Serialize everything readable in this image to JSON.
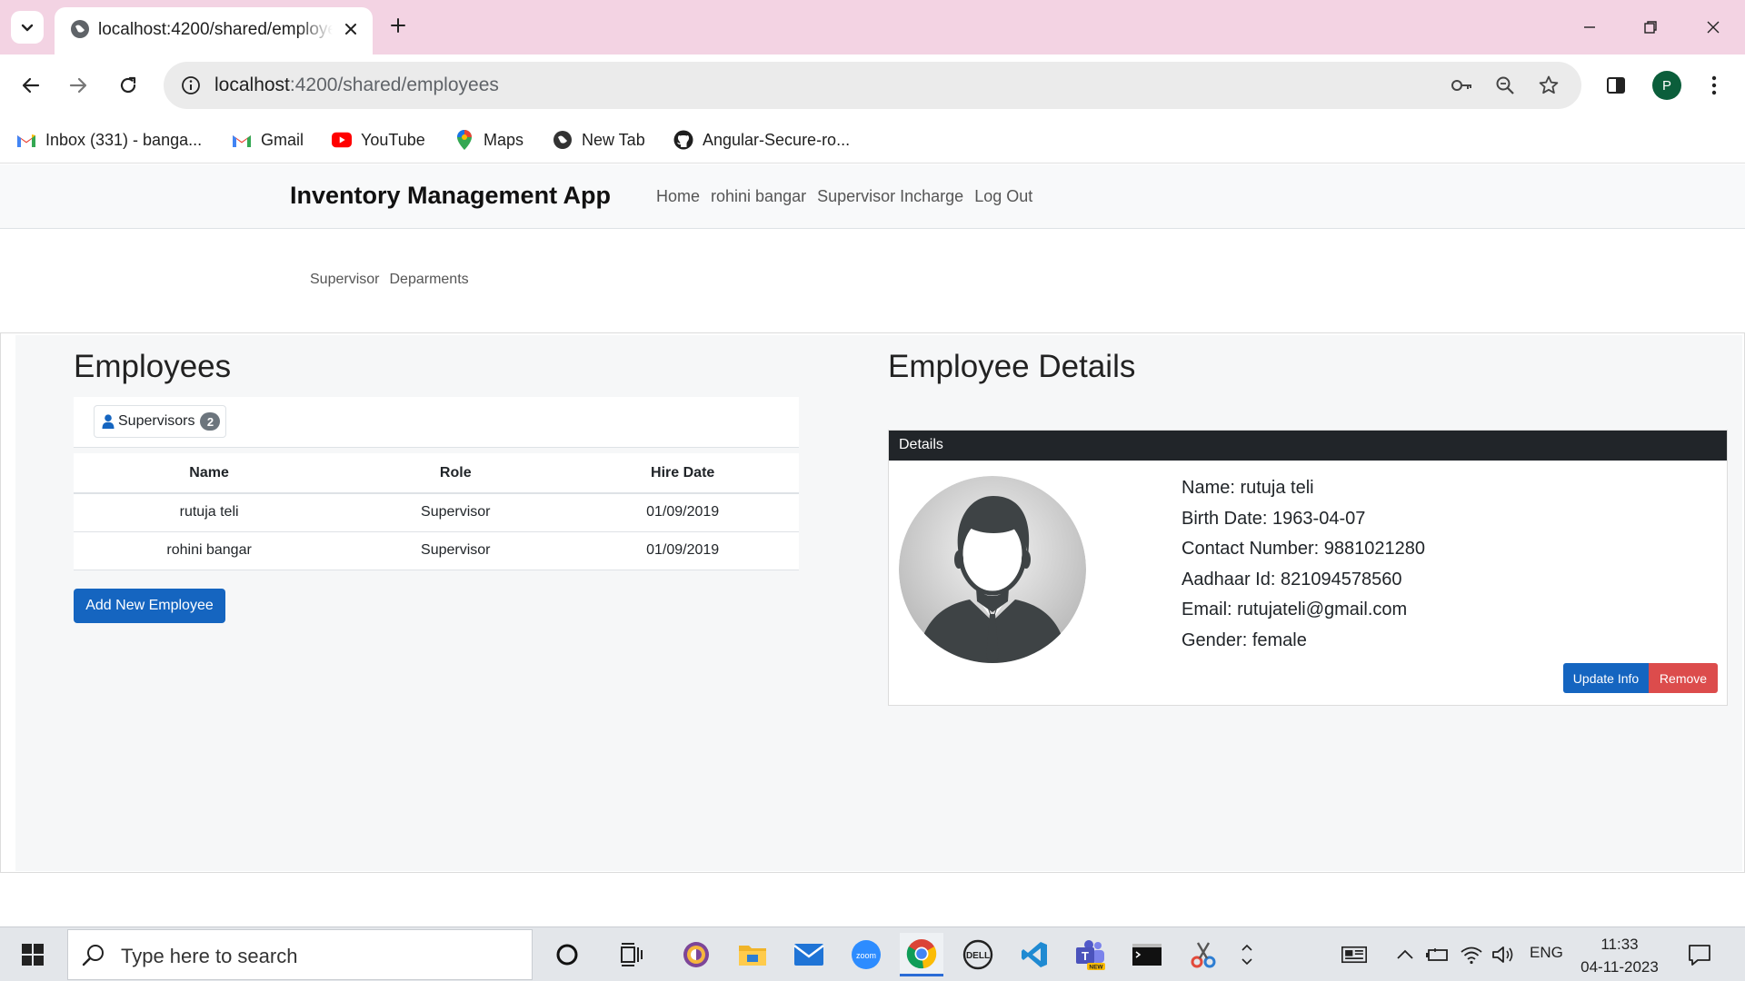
{
  "browser": {
    "tab_title": "localhost:4200/shared/employees",
    "url_host": "localhost",
    "url_rest": ":4200/shared/employees",
    "profile_initial": "P",
    "bookmarks": [
      {
        "label": "Inbox (331) - banga...",
        "icon": "gmail-icon"
      },
      {
        "label": "Gmail",
        "icon": "gmail-icon"
      },
      {
        "label": "YouTube",
        "icon": "youtube-icon"
      },
      {
        "label": "Maps",
        "icon": "maps-icon"
      },
      {
        "label": "New Tab",
        "icon": "globe-icon"
      },
      {
        "label": "Angular-Secure-ro...",
        "icon": "github-icon"
      }
    ]
  },
  "app": {
    "brand": "Inventory Management App",
    "nav": [
      "Home",
      "rohini bangar",
      "Supervisor Incharge",
      "Log Out"
    ],
    "subnav": [
      "Supervisor",
      "Deparments"
    ]
  },
  "employees": {
    "heading": "Employees",
    "tab_label": "Supervisors",
    "tab_count": "2",
    "columns": [
      "Name",
      "Role",
      "Hire Date"
    ],
    "rows": [
      [
        "rutuja teli",
        "Supervisor",
        "01/09/2019"
      ],
      [
        "rohini bangar",
        "Supervisor",
        "01/09/2019"
      ]
    ],
    "add_button": "Add New Employee"
  },
  "details": {
    "heading": "Employee Details",
    "card_header": "Details",
    "fields": [
      "Name: rutuja teli",
      "Birth Date: 1963-04-07",
      "Contact Number: 9881021280",
      "Aadhaar Id: 821094578560",
      "Email: rutujateli@gmail.com",
      "Gender: female"
    ],
    "update_button": "Update Info",
    "remove_button": "Remove"
  },
  "taskbar": {
    "search_placeholder": "Type here to search",
    "language": "ENG",
    "time": "11:33",
    "date": "04-11-2023"
  },
  "colors": {
    "tabstrip": "#f3d3e3",
    "primary": "#1565c0",
    "danger": "#dc4c4c",
    "card_header": "#212529"
  }
}
